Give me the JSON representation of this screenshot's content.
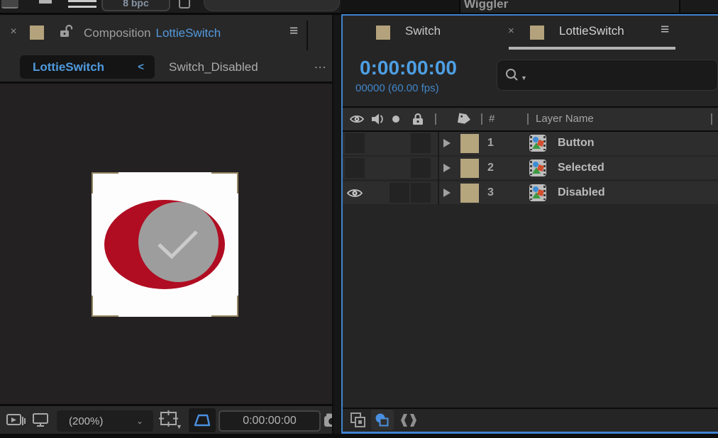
{
  "top_strip": {
    "bpc_button": "8 bpc",
    "wiggler_tab": "Wiggler"
  },
  "comp_panel": {
    "close": "×",
    "title_label": "Composition",
    "title_value": "LottieSwitch",
    "menu": "≡",
    "active_tab": "LottieSwitch",
    "active_tab_chevron": "<",
    "inactive_tab": "Switch_Disabled",
    "tab_overflow": "...",
    "zoom_value": "(200%)",
    "zoom_chevron": "⌄",
    "grid_caret": "▼",
    "time_display": "0:00:00:00"
  },
  "timeline_panel": {
    "tab_switch": "Switch",
    "tab_close": "×",
    "tab_lottieswitch": "LottieSwitch",
    "tab_menu": "≡",
    "timecode": "0:00:00:00",
    "frame_info": "00000 (60.00 fps)",
    "search_caret": "▼",
    "columns": {
      "number": "#",
      "layer_name": "Layer Name"
    },
    "layers": [
      {
        "index": "1",
        "name": "Button",
        "video_visible": false
      },
      {
        "index": "2",
        "name": "Selected",
        "video_visible": false
      },
      {
        "index": "3",
        "name": "Disabled",
        "video_visible": true
      }
    ]
  },
  "colors": {
    "accent_blue_text": "#4f9ade",
    "timecode_blue": "#4d9fe3",
    "panel_border_blue": "#3f82d0",
    "label_tan": "#b3a27c",
    "switch_red": "#b00d22",
    "knob_gray": "#9d9d9d",
    "checkmark_gray": "#cbcbcb",
    "row_bg": "#2e2d2d"
  }
}
